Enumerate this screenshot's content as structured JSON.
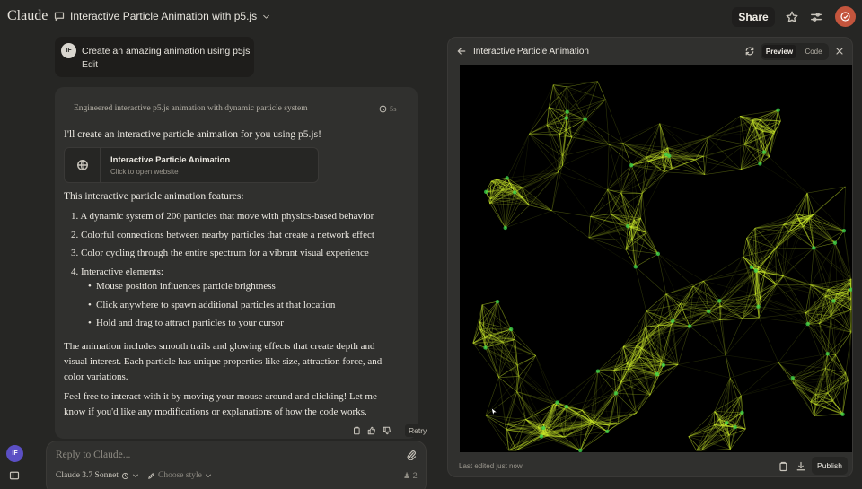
{
  "app": {
    "brand": "Claude"
  },
  "header": {
    "chat_title": "Interactive Particle Animation with p5.js",
    "share_label": "Share",
    "icons": [
      "chat-bubble-icon",
      "chevron-down-icon",
      "star-icon",
      "sliders-icon",
      "user-menu-icon"
    ],
    "accent_color": "#c4553d"
  },
  "sidebar": {
    "user_initials": "IF"
  },
  "user_message": {
    "initials": "IF",
    "text": "Create an amazing animation using p5js",
    "edit_label": "Edit"
  },
  "assistant": {
    "thinking_summary": "Engineered interactive p5.js animation with dynamic particle system",
    "thinking_time": "5s",
    "intro": "I'll create an interactive particle animation for you using p5.js!",
    "artifact": {
      "title": "Interactive Particle Animation",
      "subtitle": "Click to open website",
      "icon": "globe-icon"
    },
    "features_heading": "This interactive particle animation features:",
    "features": [
      "1. A dynamic system of 200 particles that move with physics-based behavior",
      "2. Colorful connections between nearby particles that create a network effect",
      "3. Color cycling through the entire spectrum for a vibrant visual experience",
      "4. Interactive elements:"
    ],
    "interactive_items": [
      "Mouse position influences particle brightness",
      "Click anywhere to spawn additional particles at that location",
      "Hold and drag to attract particles to your cursor"
    ],
    "paragraph_1": "The animation includes smooth trails and glowing effects that create depth and visual interest. Each particle has unique properties like size, attraction force, and color variations.",
    "paragraph_2": "Feel free to interact with it by moving your mouse around and clicking! Let me know if you'd like any modifications or explanations of how the code works.",
    "retry_label": "Retry"
  },
  "composer": {
    "placeholder": "Reply to Claude...",
    "model": "Claude 3.7 Sonnet",
    "style": "Choose style",
    "count": "2"
  },
  "artifact_panel": {
    "title": "Interactive Particle Animation",
    "tab_preview": "Preview",
    "tab_code": "Code",
    "active_tab": "Preview",
    "last_edited": "Last edited just now",
    "publish_label": "Publish",
    "particle_color": "#c8e62a",
    "glow_color": "#3cd04a"
  }
}
